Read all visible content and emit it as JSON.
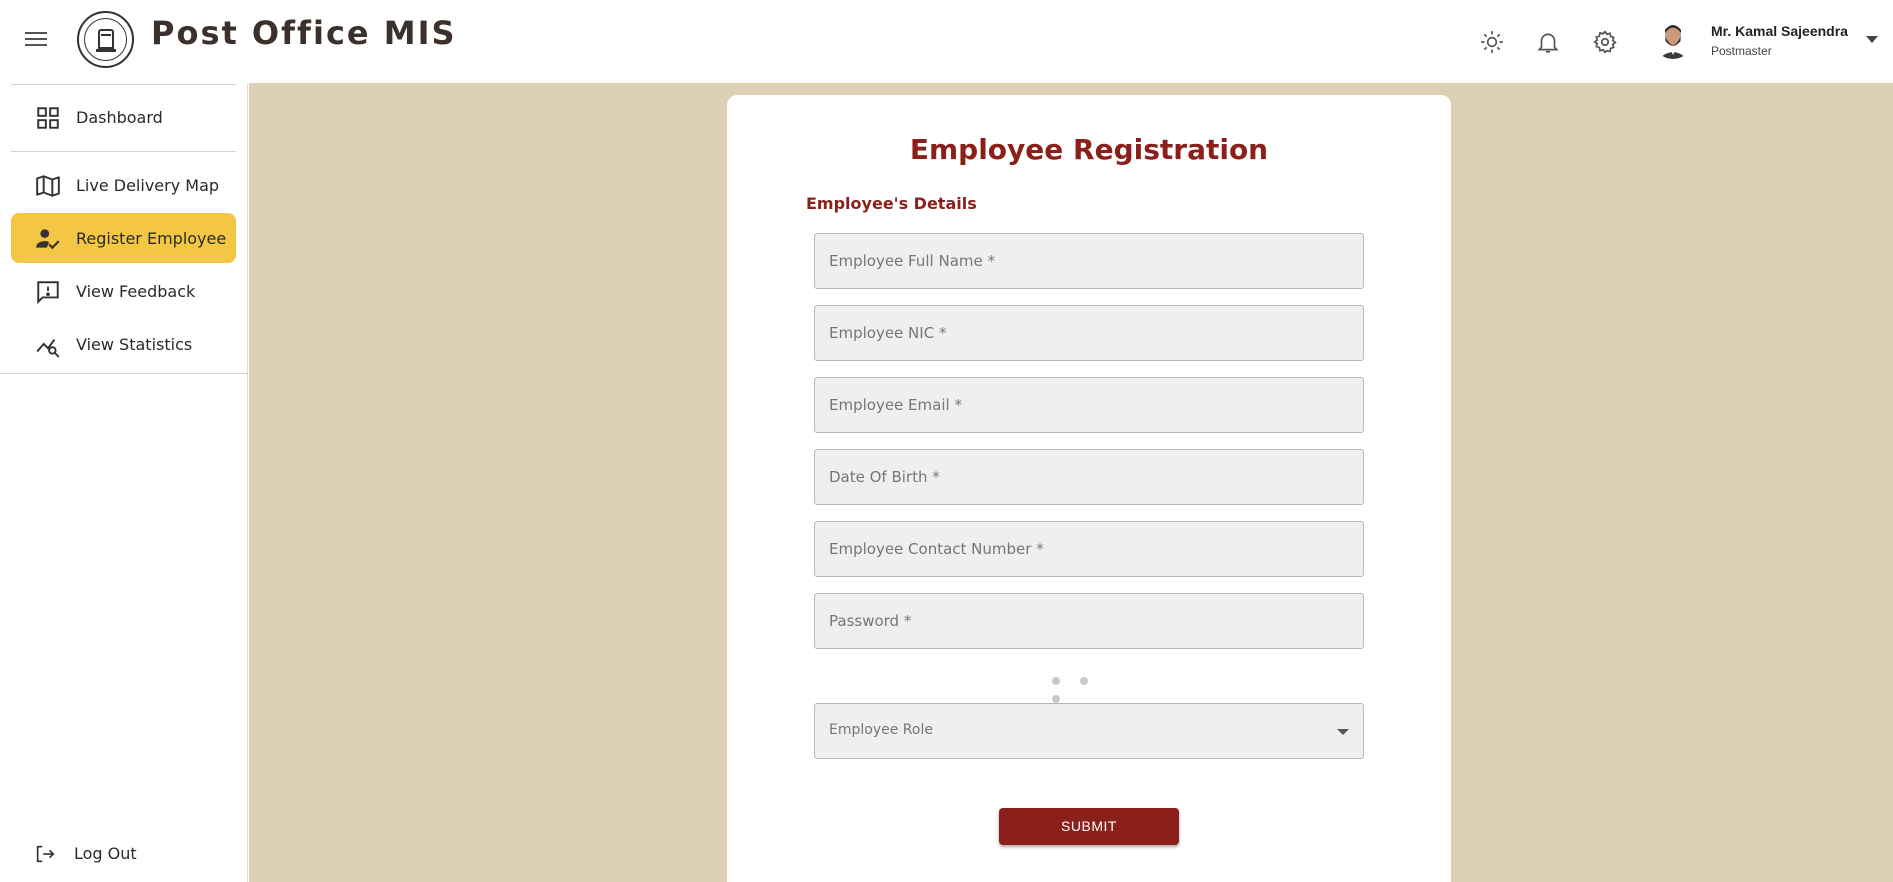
{
  "app": {
    "title": "Post Office MIS"
  },
  "user": {
    "name": "Mr. Kamal Sajeendra",
    "role": "Postmaster"
  },
  "sidebar": {
    "items": [
      {
        "label": "Dashboard",
        "icon": "grid-icon",
        "active": false
      },
      {
        "label": "Live Delivery Map",
        "icon": "map-icon",
        "active": false
      },
      {
        "label": "Register Employee",
        "icon": "person-check-icon",
        "active": true
      },
      {
        "label": "View Feedback",
        "icon": "feedback-icon",
        "active": false
      },
      {
        "label": "View Statistics",
        "icon": "statistics-icon",
        "active": false
      }
    ],
    "logout_label": "Log Out"
  },
  "form": {
    "title": "Employee Registration",
    "section": "Employee's Details",
    "fields": [
      {
        "placeholder": "Employee Full Name *"
      },
      {
        "placeholder": "Employee NIC *"
      },
      {
        "placeholder": "Employee Email *"
      },
      {
        "placeholder": "Date Of Birth *"
      },
      {
        "placeholder": "Employee Contact Number *"
      },
      {
        "placeholder": "Password *"
      }
    ],
    "role_placeholder": "Employee Role",
    "submit_label": "SUBMIT"
  },
  "colors": {
    "accent": "#8b1f1a",
    "active_nav": "#f3c743",
    "background": "#ded0b4"
  }
}
